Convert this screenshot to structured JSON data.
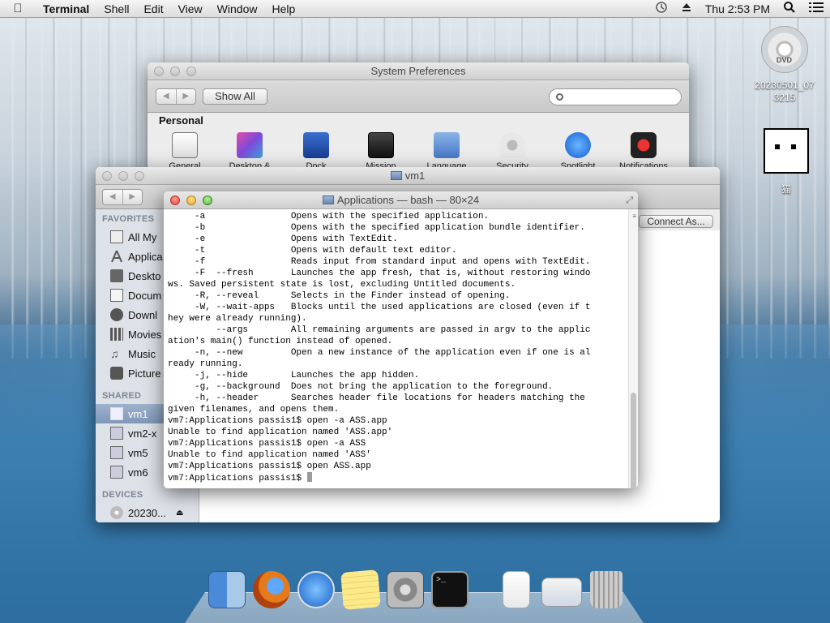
{
  "menubar": {
    "apple": "",
    "app": "Terminal",
    "items": [
      "Shell",
      "Edit",
      "View",
      "Window",
      "Help"
    ],
    "clock": "Thu 2:53 PM"
  },
  "desktop": {
    "dvd_label": "20230501_07\n3215",
    "dvd_text": "DVD",
    "cat_label": "猫"
  },
  "sysprefs": {
    "title": "System Preferences",
    "show_all": "Show All",
    "search_placeholder": "",
    "section": "Personal",
    "items": [
      "General",
      "Desktop &",
      "Dock",
      "Mission",
      "Language",
      "Security",
      "Spotlight",
      "Notifications"
    ]
  },
  "finder": {
    "title": "vm1",
    "connect_as": "Connect As...",
    "favorites_head": "FAVORITES",
    "favorites": [
      "All My",
      "Applica",
      "Deskto",
      "Docum",
      "Downl",
      "Movies",
      "Music",
      "Picture"
    ],
    "shared_head": "SHARED",
    "shared": [
      "vm1",
      "vm2-x",
      "vm5",
      "vm6"
    ],
    "devices_head": "DEVICES",
    "devices": [
      "20230..."
    ]
  },
  "terminal": {
    "title": "Applications — bash — 80×24",
    "lines": [
      "     -a                Opens with the specified application.",
      "     -b                Opens with the specified application bundle identifier.",
      "     -e                Opens with TextEdit.",
      "     -t                Opens with default text editor.",
      "     -f                Reads input from standard input and opens with TextEdit.",
      "     -F  --fresh       Launches the app fresh, that is, without restoring windo",
      "ws. Saved persistent state is lost, excluding Untitled documents.",
      "     -R, --reveal      Selects in the Finder instead of opening.",
      "     -W, --wait-apps   Blocks until the used applications are closed (even if t",
      "hey were already running).",
      "         --args        All remaining arguments are passed in argv to the applic",
      "ation's main() function instead of opened.",
      "     -n, --new         Open a new instance of the application even if one is al",
      "ready running.",
      "     -j, --hide        Launches the app hidden.",
      "     -g, --background  Does not bring the application to the foreground.",
      "     -h, --header      Searches header file locations for headers matching the",
      "given filenames, and opens them.",
      "vm7:Applications passis1$ open -a ASS.app",
      "Unable to find application named 'ASS.app'",
      "vm7:Applications passis1$ open -a ASS",
      "Unable to find application named 'ASS'",
      "vm7:Applications passis1$ open ASS.app",
      "vm7:Applications passis1$ "
    ]
  },
  "dock": {
    "items": [
      "finder",
      "firefox",
      "app-store",
      "notes",
      "system-preferences",
      "terminal",
      "document",
      "preview",
      "trash"
    ]
  }
}
